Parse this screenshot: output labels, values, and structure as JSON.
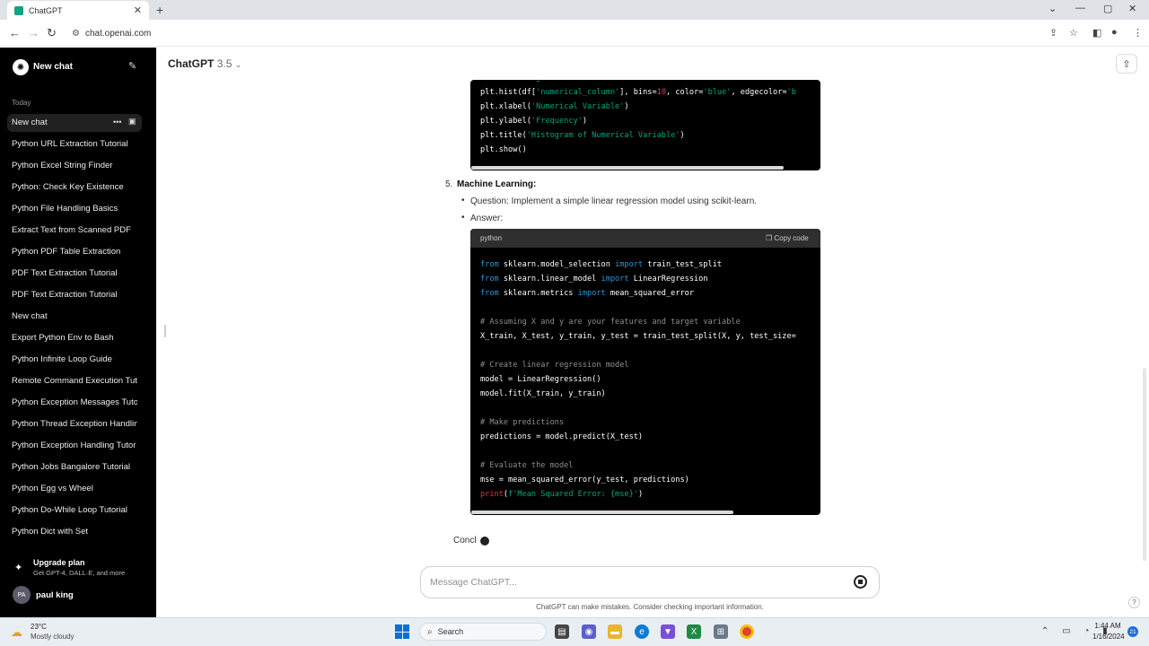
{
  "browser": {
    "tab_title": "ChatGPT",
    "url": "chat.openai.com"
  },
  "sidebar": {
    "new_chat": "New chat",
    "section_today": "Today",
    "items": [
      "New chat",
      "Python URL Extraction Tutorial",
      "Python Excel String Finder",
      "Python: Check Key Existence",
      "Python File Handling Basics",
      "Extract Text from Scanned PDF",
      "Python PDF Table Extraction",
      "PDF Text Extraction Tutorial",
      "PDF Text Extraction Tutorial",
      "New chat",
      "Export Python Env to Bash",
      "Python Infinite Loop Guide",
      "Remote Command Execution Tuto",
      "Python Exception Messages Tuto",
      "Python Thread Exception Handlin",
      "Python Exception Handling Tutor",
      "Python Jobs Bangalore Tutorial",
      "Python Egg vs Wheel",
      "Python Do-While Loop Tutorial",
      "Python Dict with Set"
    ],
    "upgrade_title": "Upgrade plan",
    "upgrade_sub": "Get GPT-4, DALL·E, and more",
    "user_initials": "PA",
    "user_name": "paul king"
  },
  "header": {
    "model_name": "ChatGPT",
    "model_version": "3.5"
  },
  "content": {
    "code1_lines": [
      "# Plot histogram",
      "plt.hist(df['numerical_column'], bins=10, color='blue', edgecolor='b",
      "plt.xlabel('Numerical Variable')",
      "plt.ylabel('Frequency')",
      "plt.title('Histogram of Numerical Variable')",
      "plt.show()"
    ],
    "item_number": "5.",
    "item_title": "Machine Learning:",
    "question": "Question: Implement a simple linear regression model using scikit-learn.",
    "answer": "Answer:",
    "code_lang": "python",
    "copy_label": "Copy code",
    "code2_lines": [
      "from sklearn.model_selection import train_test_split",
      "from sklearn.linear_model import LinearRegression",
      "from sklearn.metrics import mean_squared_error",
      "",
      "# Assuming X and y are your features and target variable",
      "X_train, X_test, y_train, y_test = train_test_split(X, y, test_size=",
      "",
      "# Create linear regression model",
      "model = LinearRegression()",
      "model.fit(X_train, y_train)",
      "",
      "# Make predictions",
      "predictions = model.predict(X_test)",
      "",
      "# Evaluate the model",
      "mse = mean_squared_error(y_test, predictions)",
      "print(f'Mean Squared Error: {mse}')"
    ],
    "partial_text": "Concl"
  },
  "composer": {
    "placeholder": "Message ChatGPT...",
    "disclaimer": "ChatGPT can make mistakes. Consider checking important information."
  },
  "taskbar": {
    "weather_temp": "23°C",
    "weather_desc": "Mostly cloudy",
    "search_label": "Search",
    "time": "1:44 AM",
    "date": "1/16/2024",
    "notifications": "21"
  },
  "colors": {
    "sidebar_bg": "#000000",
    "accent": "#10a37f",
    "code_keyword": "#2e95d3",
    "code_string": "#00a67d"
  }
}
